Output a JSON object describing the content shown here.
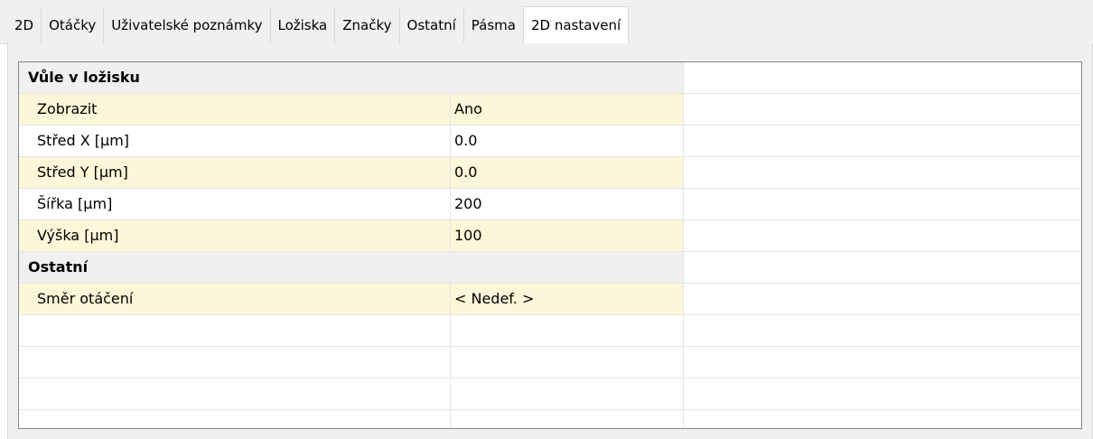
{
  "tabs": [
    {
      "label": "2D",
      "active": false
    },
    {
      "label": "Otáčky",
      "active": false
    },
    {
      "label": "Uživatelské poznámky",
      "active": false
    },
    {
      "label": "Ložiska",
      "active": false
    },
    {
      "label": "Značky",
      "active": false
    },
    {
      "label": "Ostatní",
      "active": false
    },
    {
      "label": "Pásma",
      "active": false
    },
    {
      "label": "2D nastavení",
      "active": true
    }
  ],
  "grid": {
    "sections": [
      {
        "title": "Vůle v ložisku",
        "properties": [
          {
            "name": "Zobrazit",
            "value": "Ano"
          },
          {
            "name": "Střed X [µm]",
            "value": "0.0"
          },
          {
            "name": "Střed Y [µm]",
            "value": "0.0"
          },
          {
            "name": "Šířka [µm]",
            "value": "200"
          },
          {
            "name": "Výška [µm]",
            "value": "100"
          }
        ]
      },
      {
        "title": "Ostatní",
        "properties": [
          {
            "name": "Směr otáčení",
            "value": "< Nedef. >"
          }
        ]
      }
    ]
  },
  "colors": {
    "alternate_row": "#fdf6d9",
    "category_row": "#f0f0f0",
    "grid_border": "#828790"
  }
}
